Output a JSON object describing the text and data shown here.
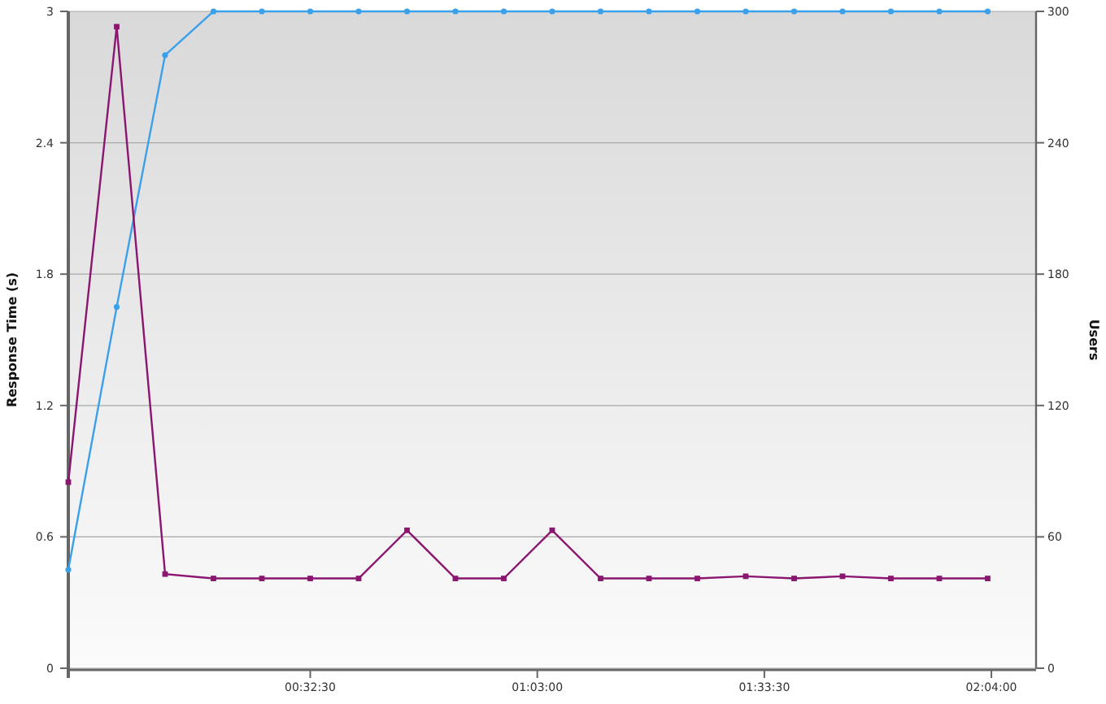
{
  "chart": {
    "chart_data": {
      "type": "line",
      "grid": true,
      "ylabel": "Response Time (s)",
      "y2label": "Users",
      "x": [
        0,
        6.5,
        13,
        19.5,
        26,
        32.5,
        39,
        45.5,
        52,
        58.5,
        65,
        71.5,
        78,
        84.5,
        91,
        97.5,
        104,
        110.5,
        117,
        123.5
      ],
      "xlim": [
        0,
        130
      ],
      "xticks": [
        {
          "value": 32.5,
          "label": "00:32:30"
        },
        {
          "value": 63,
          "label": "01:03:00"
        },
        {
          "value": 93.5,
          "label": "01:33:30"
        },
        {
          "value": 124,
          "label": "02:04:00"
        }
      ],
      "ylim": [
        0,
        3
      ],
      "yticks": [
        {
          "value": 0,
          "label": "0"
        },
        {
          "value": 0.6,
          "label": "0.6"
        },
        {
          "value": 1.2,
          "label": "1.2"
        },
        {
          "value": 1.8,
          "label": "1.8"
        },
        {
          "value": 2.4,
          "label": "2.4"
        },
        {
          "value": 3,
          "label": "3"
        }
      ],
      "y2lim": [
        0,
        300
      ],
      "y2ticks": [
        0,
        60,
        120,
        180,
        240,
        300
      ],
      "series": [
        {
          "color": "#3aa0ea",
          "axis": "y2",
          "marker": "circle",
          "values": [
            45,
            165,
            280,
            300,
            300,
            300,
            300,
            300,
            300,
            300,
            300,
            300,
            300,
            300,
            300,
            300,
            300,
            300,
            300,
            300
          ]
        },
        {
          "color": "#8a1670",
          "marker": "square",
          "values": [
            0.85,
            2.93,
            0.43,
            0.41,
            0.41,
            0.41,
            0.41,
            0.63,
            0.41,
            0.41,
            0.63,
            0.41,
            0.41,
            0.41,
            0.42,
            0.41,
            0.42,
            0.41,
            0.41,
            0.41
          ]
        }
      ]
    }
  }
}
